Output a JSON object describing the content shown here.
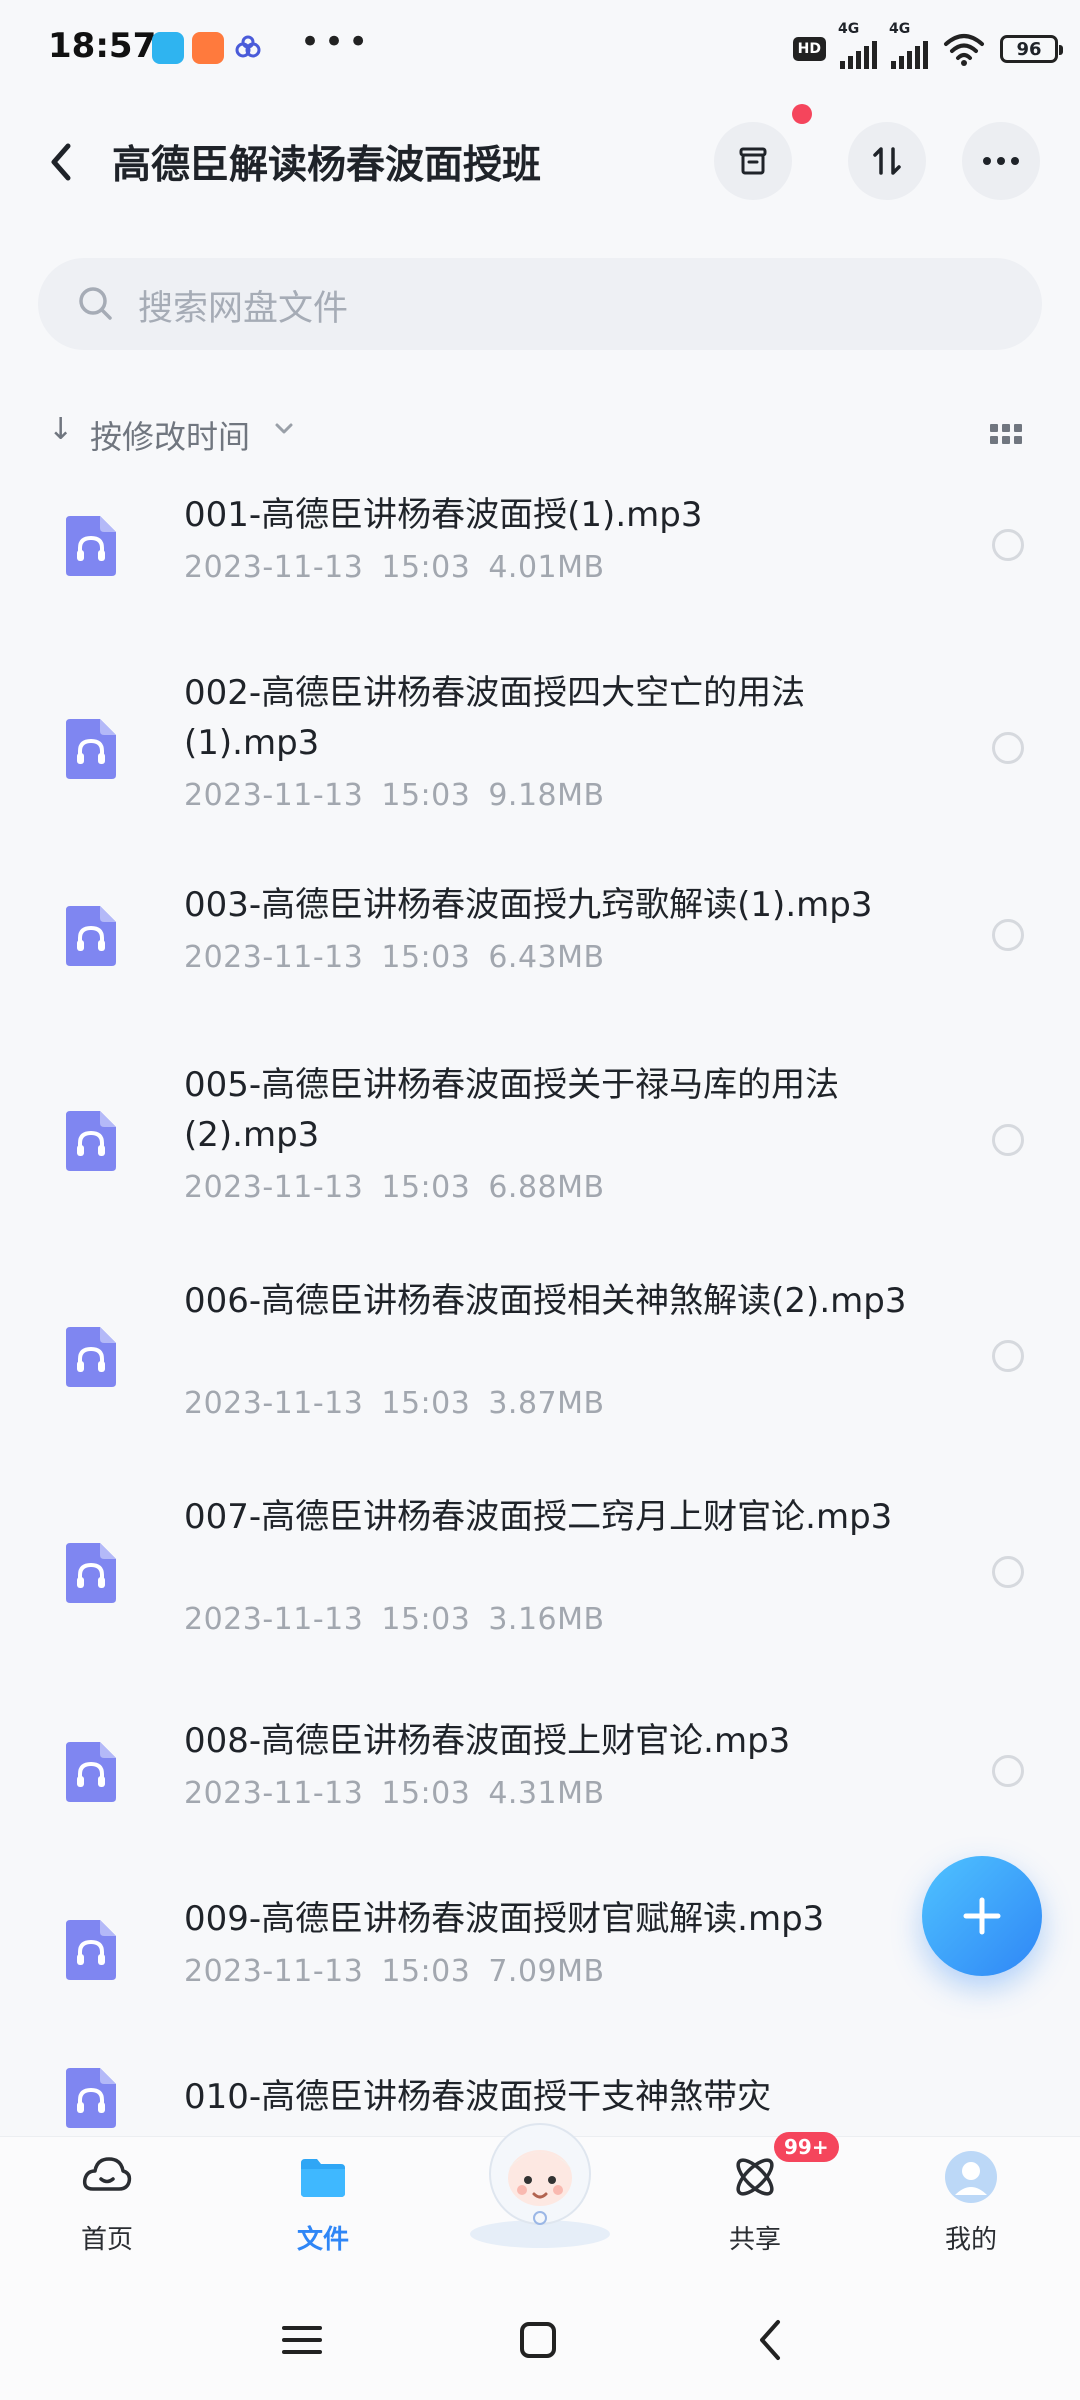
{
  "status_bar": {
    "time": "18:57",
    "hd": "HD",
    "net1": "4G",
    "net2": "4G",
    "battery": "96",
    "more": "•••"
  },
  "header": {
    "title": "高德臣解读杨春波面授班"
  },
  "search": {
    "placeholder": "搜索网盘文件"
  },
  "sort": {
    "arrow": "↓",
    "label": "按修改时间"
  },
  "files": [
    {
      "name": "001-高德臣讲杨春波面授(1).mp3",
      "date": "2023-11-13",
      "time": "15:03",
      "size": "4.01MB"
    },
    {
      "name": "002-高德臣讲杨春波面授四大空亡的用法(1).mp3",
      "date": "2023-11-13",
      "time": "15:03",
      "size": "9.18MB"
    },
    {
      "name": "003-高德臣讲杨春波面授九窍歌解读(1).mp3",
      "date": "2023-11-13",
      "time": "15:03",
      "size": "6.43MB"
    },
    {
      "name": "005-高德臣讲杨春波面授关于禄马库的用法(2).mp3",
      "date": "2023-11-13",
      "time": "15:03",
      "size": "6.88MB"
    },
    {
      "name": "006-高德臣讲杨春波面授相关神煞解读(2).mp3",
      "date": "2023-11-13",
      "time": "15:03",
      "size": "3.87MB"
    },
    {
      "name": "007-高德臣讲杨春波面授二窍月上财官论.mp3",
      "date": "2023-11-13",
      "time": "15:03",
      "size": "3.16MB"
    },
    {
      "name": "008-高德臣讲杨春波面授上财官论.mp3",
      "date": "2023-11-13",
      "time": "15:03",
      "size": "4.31MB"
    },
    {
      "name": "009-高德臣讲杨春波面授财官赋解读.mp3",
      "date": "2023-11-13",
      "time": "15:03",
      "size": "7.09MB"
    },
    {
      "name": "010-高德臣讲杨春波面授干支神煞带灾",
      "date": "",
      "time": "",
      "size": ""
    }
  ],
  "tabs": {
    "home": "首页",
    "files": "文件",
    "share": "共享",
    "share_badge": "99+",
    "me": "我的"
  },
  "colors": {
    "accent": "#2f86f6",
    "file_icon": "#7f86f1",
    "badge": "#f5455c"
  }
}
